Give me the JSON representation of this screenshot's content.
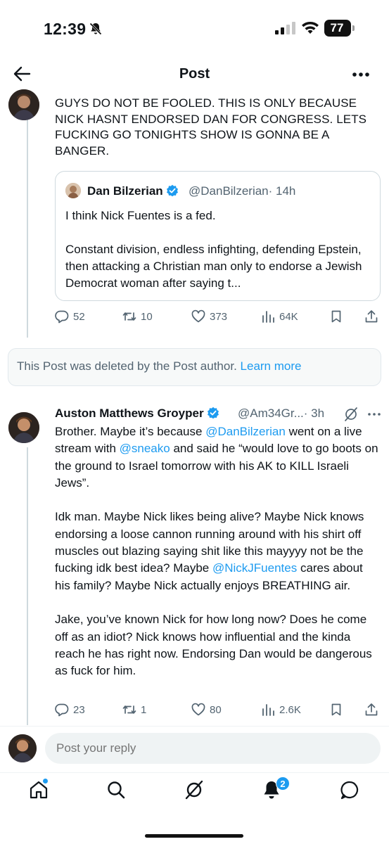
{
  "status_bar": {
    "time": "12:39",
    "battery": "77"
  },
  "header": {
    "title": "Post"
  },
  "post1": {
    "text": "GUYS DO NOT BE FOOLED. THIS IS ONLY BECAUSE NICK HASNT ENDORSED DAN FOR CONGRESS. LETS FUCKING GO TONIGHTS SHOW IS GONNA BE A BANGER.",
    "quote": {
      "name": "Dan Bilzerian",
      "handle": "@DanBilzerian",
      "time": "· 14h",
      "line1": "I think Nick Fuentes is a fed.",
      "line2": "Constant division, endless infighting, defending Epstein, then attacking a Christian man only to endorse a Jewish Democrat woman after saying t..."
    },
    "stats": {
      "replies": "52",
      "reposts": "10",
      "likes": "373",
      "views": "64K"
    }
  },
  "deleted_notice": {
    "text": "This Post was deleted by the Post author.",
    "link": "Learn more"
  },
  "post2": {
    "name": "Auston Matthews Groyper",
    "handle": "@Am34Gr...",
    "time": "· 3h",
    "p1_a": "Brother. Maybe it’s because ",
    "mention1": "@DanBilzerian",
    "p1_b": " went on a live stream with ",
    "mention2": "@sneako",
    "p1_c": " and said he “would love to go boots on the ground to Israel  tomorrow with his AK to KILL Israeli Jews”.",
    "p2_a": "Idk man. Maybe Nick likes being alive? Maybe Nick knows endorsing a loose cannon running around with his shirt off muscles out blazing saying shit like this mayyyy not be the fucking idk best idea? Maybe ",
    "mention3": "@NickJFuentes",
    "p2_b": " cares about his family? Maybe Nick actually enjoys BREATHING air.",
    "p3": "Jake, you’ve known Nick for how long now? Does he come off as an idiot? Nick knows how influential and the kinda reach he has right now. Endorsing Dan would be dangerous as fuck for him.",
    "stats": {
      "replies": "23",
      "reposts": "1",
      "likes": "80",
      "views": "2.6K"
    }
  },
  "reply": {
    "placeholder": "Post your reply"
  },
  "nav": {
    "notifications_badge": "2"
  },
  "colors": {
    "accent": "#1d9bf0",
    "text": "#0f1419",
    "muted": "#536471",
    "border": "#cfd9de"
  },
  "icons": [
    "bell-off-icon",
    "signal-icon",
    "wifi-icon",
    "battery-icon",
    "back-arrow-icon",
    "more-icon",
    "verified-icon",
    "grok-icon",
    "reply-icon",
    "repost-icon",
    "like-icon",
    "views-icon",
    "bookmark-icon",
    "share-icon",
    "home-icon",
    "search-icon",
    "notifications-icon",
    "messages-icon"
  ]
}
